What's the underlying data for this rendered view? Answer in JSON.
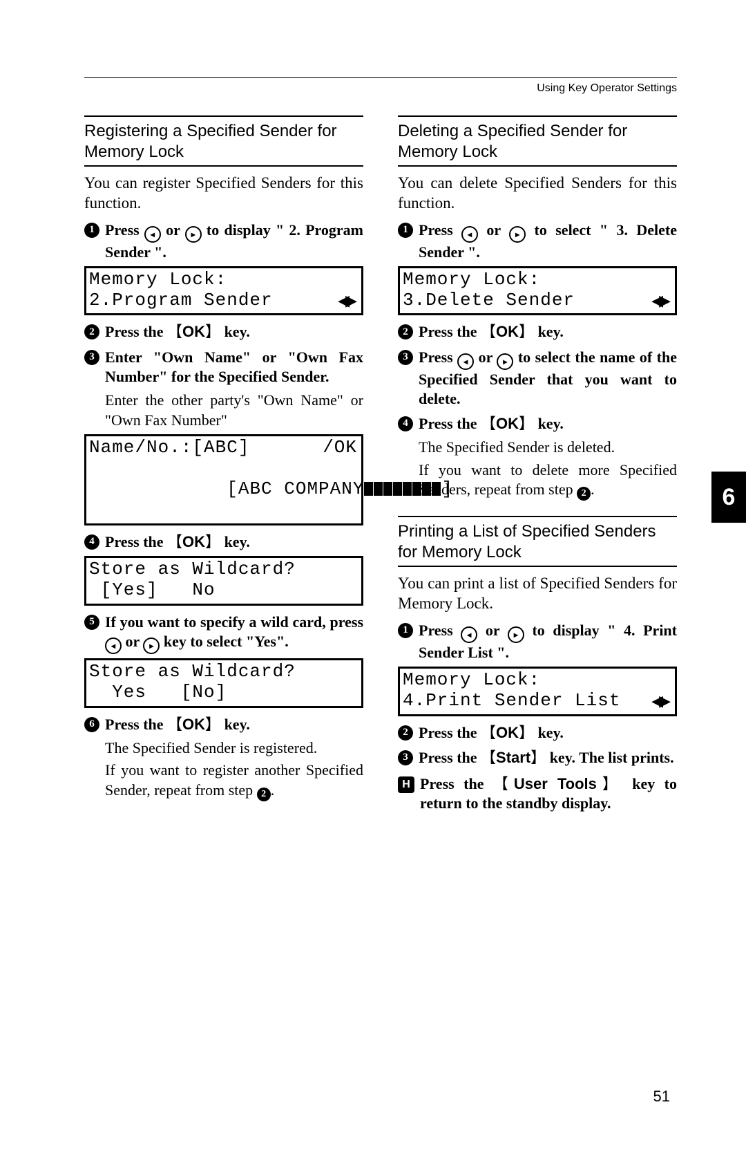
{
  "header": {
    "label": "Using Key Operator Settings"
  },
  "side_tab": "6",
  "page_number": "51",
  "keys": {
    "ok": "OK",
    "start": "Start",
    "user_tools": "User Tools"
  },
  "arrows": {
    "left_glyph": "◂",
    "right_glyph": "▸",
    "lcd_pair": "◀▶"
  },
  "col1": {
    "sec1": {
      "title": "Registering a Specified Sender for Memory Lock",
      "intro": "You can register Specified Senders for this function.",
      "s1_a": "Press ",
      "s1_b": " or ",
      "s1_c": " to display \" 2. Program Sender \".",
      "lcd1_l1": "Memory Lock:",
      "lcd1_l2": "2.Program Sender",
      "s2_a": "Press the ",
      "s2_b": " key.",
      "s3": "Enter \"Own Name\" or \"Own Fax Number\" for the Specified Sender.",
      "s3_note": "Enter the other party's \"Own Name\" or \"Own Fax Number\"",
      "lcd2_l1_left": "Name/No.:[ABC]",
      "lcd2_l1_right": "/OK",
      "lcd2_l2_left": "[ABC COMPANY",
      "lcd2_l2_right": "]",
      "s4_a": "Press the ",
      "s4_b": " key.",
      "lcd3_l1": "Store as Wildcard?",
      "lcd3_l2": " [Yes]   No",
      "s5_a": "If you want to specify a wild card, press ",
      "s5_b": " or ",
      "s5_c": " key to select \"Yes\".",
      "lcd4_l1": "Store as Wildcard?",
      "lcd4_l2": "  Yes   [No]",
      "s6_a": "Press the ",
      "s6_b": " key.",
      "s6_note1": "The Specified Sender is registered.",
      "s6_note2_a": "If you want to register another Specified Sender, repeat from step ",
      "s6_note2_b": "."
    }
  },
  "col2": {
    "sec1": {
      "title": "Deleting a Specified Sender for Memory Lock",
      "intro": "You can delete Specified Senders for this function.",
      "s1_a": "Press ",
      "s1_b": " or ",
      "s1_c": " to select \" 3. Delete Sender \".",
      "lcd1_l1": "Memory Lock:",
      "lcd1_l2": "3.Delete Sender",
      "s2_a": "Press the ",
      "s2_b": " key.",
      "s3_a": "Press ",
      "s3_b": " or ",
      "s3_c": " to select the name of the Specified Sender that you want to delete.",
      "s4_a": "Press the ",
      "s4_b": " key.",
      "s4_note1": "The Specified Sender is deleted.",
      "s4_note2_a": "If you want to delete more Specified Senders, repeat from step ",
      "s4_note2_b": "."
    },
    "sec2": {
      "title": "Printing a List of Specified Senders for Memory Lock",
      "intro": "You can print a list of Specified Senders for Memory Lock.",
      "s1_a": "Press ",
      "s1_b": " or ",
      "s1_c": " to display \" 4. Print Sender List \".",
      "lcd1_l1": "Memory Lock:",
      "lcd1_l2": "4.Print Sender List",
      "s2_a": "Press the ",
      "s2_b": " key.",
      "s3_a": "Press the ",
      "s3_b": " key. The list prints."
    },
    "major": {
      "a": "Press the ",
      "b": " key to return to the standby display."
    }
  }
}
